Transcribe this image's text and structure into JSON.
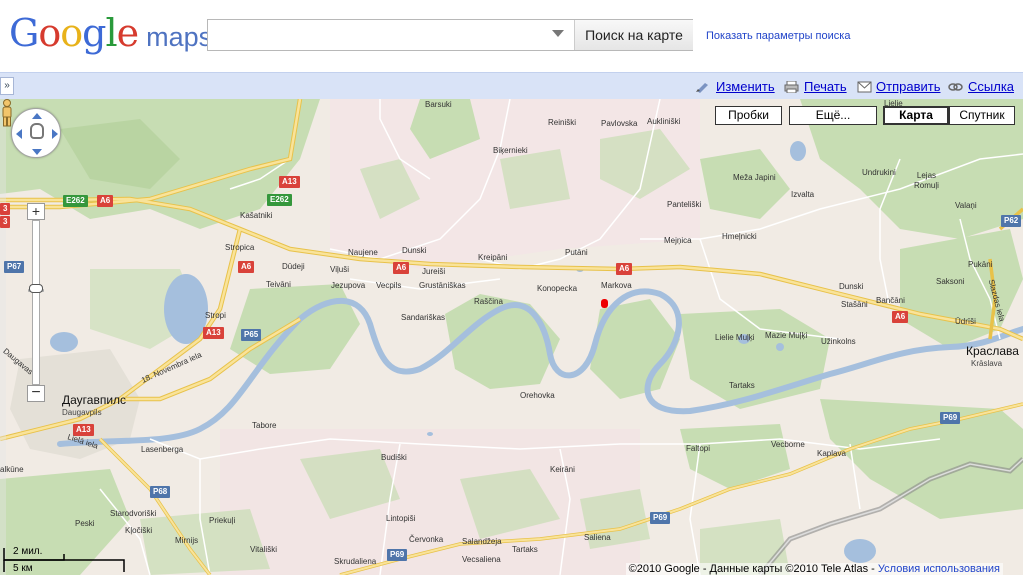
{
  "header": {
    "logo_text": "Google",
    "logo_maps": "maps",
    "search": {
      "value": "",
      "placeholder": ""
    },
    "search_button_label": "Поиск на карте",
    "search_options_link": "Показать параметры поиска"
  },
  "toolbar": {
    "collapse_label": "»",
    "edit_label": "Изменить",
    "print_label": "Печать",
    "send_label": "Отправить",
    "link_label": "Ссылка"
  },
  "map_types": {
    "traffic_label": "Пробки",
    "more_label": "Ещё...",
    "map_label": "Карта",
    "satellite_label": "Спутник",
    "active": "Карта"
  },
  "zoom": {
    "plus_label": "+",
    "minus_label": "−"
  },
  "scale": {
    "miles_label": "2 мил.",
    "km_label": "5 км"
  },
  "copyright": {
    "text": "©2010 Google - Данные карты ©2010 Tele Atlas -",
    "terms_link": "Условия использования"
  },
  "colors": {
    "water": "#a5bfdd",
    "forest": "#c8dfb6",
    "land": "#efeae4",
    "highway": "#f6d86a",
    "road_red": "#d9423a",
    "road_green": "#35973c",
    "road_blue": "#4f75aa",
    "toolbar_bg": "#d9e3f7",
    "link": "#2144c9"
  },
  "places": {
    "barsuki": "Barsuki",
    "reinishki": "Reiniški",
    "pavlovska": "Pavlovska",
    "aukliniski": "Aukliniški",
    "bikernieki": "Biķernieki",
    "kasatniki": "Kašatniki",
    "stropica": "Stropica",
    "naujene": "Naujene",
    "dunski": "Dunski",
    "kreipani": "Kreipāni",
    "putani": "Putāni",
    "mejnica": "Mejņica",
    "panteliski": "Panteliški",
    "meza_japini": "Meža Japini",
    "izvalta": "Izvalta",
    "undrukini": "Undrukini",
    "lejas_romuli": "Lejas\nRomuļi",
    "valani": "Valaņi",
    "hmelnicki": "Hmeļnicki",
    "dudeji": "Dūdeji",
    "viljusi": "Viļuši",
    "jureisi": "Jureiši",
    "grustaniskas": "Grustāniškas",
    "konopecka": "Konopecka",
    "markova": "Markova",
    "teivani": "Teivāni",
    "jezupova": "Jezupova",
    "vecpils": "Vecpils",
    "rascina": "Raščina",
    "stropi": "Stropi",
    "sandariskas": "Sandariškas",
    "dunski_east": "Dunski",
    "bancani": "Bančāni",
    "stasani": "Stašāni",
    "saksoni": "Saksoni",
    "pukani": "Pukāni",
    "udritsi": "Ūdrīši",
    "lielie_mulki": "Lielie Muļķi",
    "maze_mulki": "Mazie Muļķi",
    "uzinkolns": "Užinkolns",
    "kraslava": "Краслава",
    "kraslava_sub": "Krāslava",
    "tartaks": "Tartaks",
    "daugavpils": "Даугавпилс",
    "daugavpils_sub": "Daugavpils",
    "tabore": "Tabore",
    "orehovka": "Orehovka",
    "lasenberga": "Lasenberga",
    "budiski": "Budiški",
    "faltopi": "Faltopi",
    "vecborne": "Vecborne",
    "kaplava": "Kaplava",
    "keirani": "Keirāni",
    "kalkune": "alkūne",
    "starodvoriski": "Starodvoriški",
    "kjociski": "Kļočiški",
    "peski": "Peski",
    "mirnijs": "Mirnijs",
    "priekuli": "Priekuļi",
    "lintopisi": "Lintopiši",
    "cervonka": "Červonka",
    "salandzeja": "Salandžeja",
    "tartaks_south": "Tartaks",
    "saliena": "Saliena",
    "vitaliski": "Vitališki",
    "skrudaliena": "Skrudaliena",
    "vecsaliena": "Vecsaliena",
    "lielie": "Lielie"
  },
  "roads": {
    "a13_1": "A13",
    "a13_2": "A13",
    "a13_3": "A13",
    "a6_1": "A6",
    "a6_2": "A6",
    "a6_3": "A6",
    "a6_4": "A6",
    "a6_5": "A6",
    "e262_1": "E262",
    "e262_2": "E262",
    "p67": "P67",
    "p65": "P65",
    "p68": "P68",
    "p69_1": "P69",
    "p69_2": "P69",
    "p69_3": "P69",
    "p62": "P62",
    "left_3a": "3",
    "left_3b": "3",
    "street_18nov": "18. Novembra iela",
    "street_lielaiela": "Lielā iela",
    "street_daugavas": "Daugavas",
    "street_slazlas": "Slazdas iela"
  }
}
